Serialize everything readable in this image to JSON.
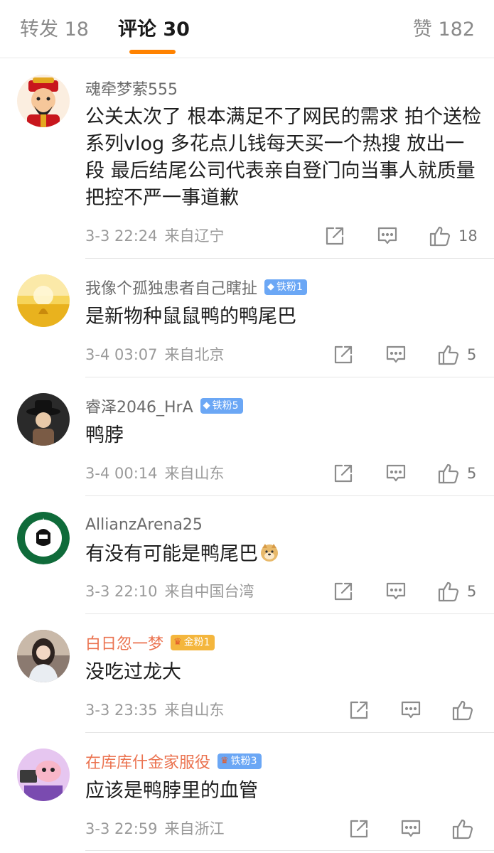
{
  "tabs": {
    "repost": "转发 18",
    "comments": "评论 30",
    "likes": "赞 182"
  },
  "colors": {
    "accent": "#ff8200",
    "vip_name": "#eb7350",
    "badge_blue": "#6ba7f5",
    "badge_gold": "#f4b63d"
  },
  "comments": [
    {
      "username": "魂牵梦萦555",
      "text": "公关太次了 根本满足不了网民的需求  拍个送检系列vlog 多花点儿钱每天买一个热搜 放出一段   最后结尾公司代表亲自登门向当事人就质量把控不严一事道歉",
      "time": "3-3 22:24",
      "source": "来自辽宁",
      "likes": "18",
      "avatar_icon": "cartoon-god-of-wealth-avatar"
    },
    {
      "username": "我像个孤独患者自己瞎扯",
      "badge": "铁粉1",
      "badge_icon": "diamond-icon",
      "text": "是新物种鼠鼠鸭的鸭尾巴",
      "time": "3-4 03:07",
      "source": "来自北京",
      "likes": "5",
      "avatar_icon": "golden-field-avatar"
    },
    {
      "username": "睿泽2046_HrA",
      "badge": "铁粉5",
      "badge_icon": "diamond-icon",
      "text": "鸭脖",
      "time": "3-4 00:14",
      "source": "来自山东",
      "likes": "5",
      "avatar_icon": "figure-in-hat-avatar"
    },
    {
      "username": "AllianzArena25",
      "text": "有没有可能是鸭尾巴",
      "emoji_icon": "doge-emoji",
      "time": "3-3 22:10",
      "source": "来自中国台湾",
      "likes": "5",
      "avatar_icon": "star-wars-coffee-logo-avatar"
    },
    {
      "username": "白日忽一梦",
      "badge": "金粉1",
      "badge_icon": "crown-icon",
      "text": "没吃过龙大",
      "time": "3-3 23:35",
      "source": "来自山东",
      "likes": "",
      "avatar_icon": "girl-portrait-avatar"
    },
    {
      "username": "在库库什金家服役",
      "badge": "铁粉3",
      "badge_icon": "crown-icon",
      "text": "应该是鸭脖里的血管",
      "time": "3-3 22:59",
      "source": "来自浙江",
      "likes": "",
      "avatar_icon": "pink-cartoon-avatar"
    }
  ]
}
